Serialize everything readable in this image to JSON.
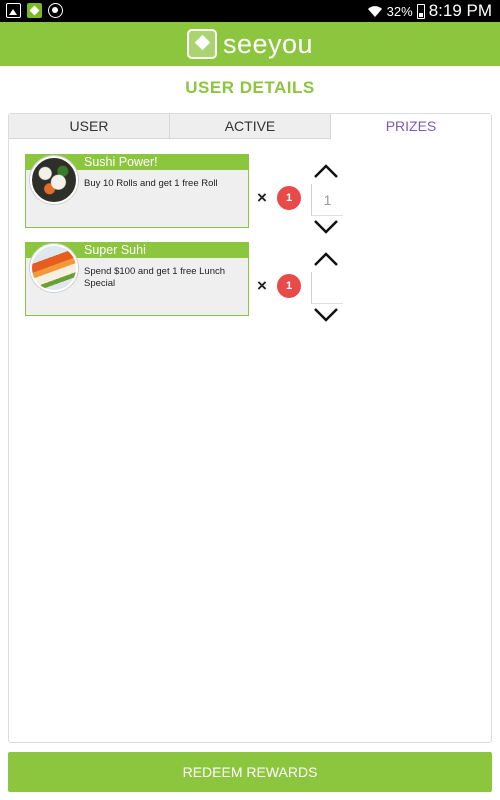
{
  "status_bar": {
    "battery": "32%",
    "time": "8:19 PM"
  },
  "header": {
    "app_name": "seeyou"
  },
  "page": {
    "title": "USER DETAILS"
  },
  "tabs": [
    {
      "label": "USER",
      "active": false
    },
    {
      "label": "ACTIVE",
      "active": false
    },
    {
      "label": "PRIZES",
      "active": true
    }
  ],
  "prizes": [
    {
      "title": "Sushi Power!",
      "description": "Buy 10 Rolls and get 1 free Roll",
      "multiply_symbol": "×",
      "badge_count": "1",
      "quantity": "1"
    },
    {
      "title": "Super Suhi",
      "description": "Spend $100 and get 1 free Lunch Special",
      "multiply_symbol": "×",
      "badge_count": "1",
      "quantity": ""
    }
  ],
  "actions": {
    "redeem_label": "REDEEM REWARDS"
  },
  "colors": {
    "brand_green": "#8cc63f",
    "active_tab_text": "#7a5bb5",
    "badge_red": "#e84a4a"
  },
  "icons": {
    "status_left": [
      "photo-icon",
      "app-icon",
      "chrome-icon"
    ],
    "status_right": [
      "wifi-icon",
      "battery-icon"
    ],
    "stepper": [
      "chevron-up-icon",
      "chevron-down-icon"
    ],
    "logo": "seeyou-logo-icon"
  }
}
